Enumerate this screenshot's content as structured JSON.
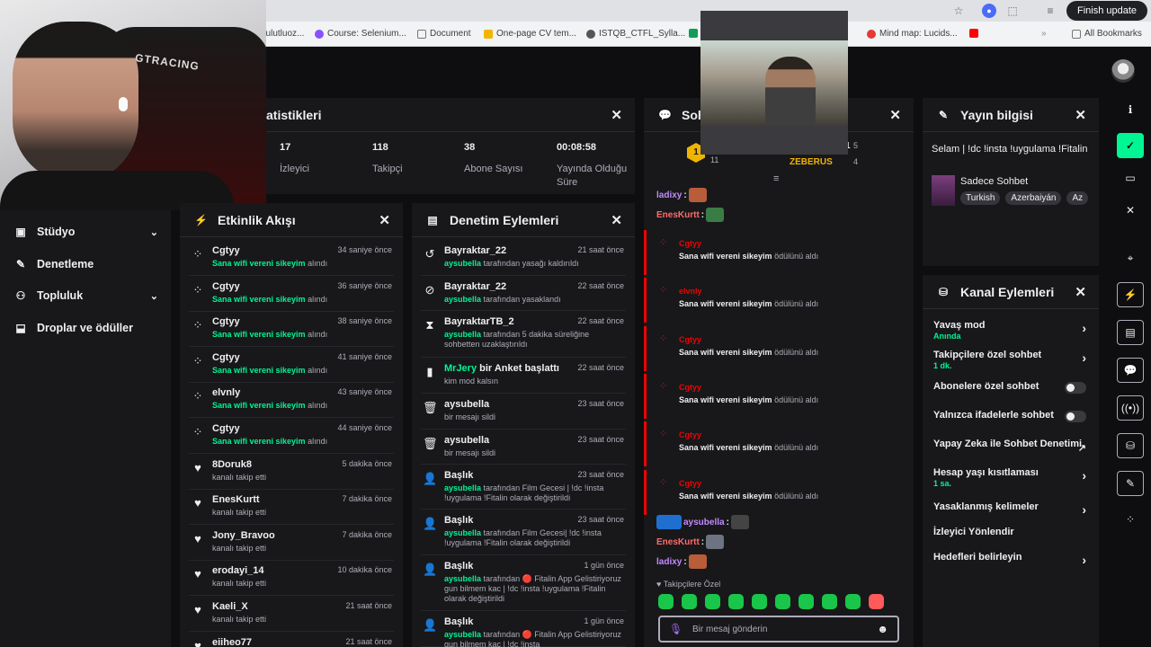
{
  "browser": {
    "bookmarks": [
      {
        "label": "bulutluoz...",
        "color": "#777"
      },
      {
        "label": "Course: Selenium...",
        "color": "#8a4fff"
      },
      {
        "label": "Document",
        "color": "#777"
      },
      {
        "label": "One-page CV tem...",
        "color": "#f4b400"
      },
      {
        "label": "ISTQB_CTFL_Sylla...",
        "color": "#555"
      },
      {
        "label": "Mind map: Lucids...",
        "color": "#e53935"
      },
      {
        "label": "All Bookmarks",
        "color": "#777"
      }
    ],
    "finish_update": "Finish update"
  },
  "webcam": {
    "chair_text": "GTRACING"
  },
  "leftnav": {
    "items": [
      {
        "label": "Stüdyo",
        "icon": "studio-icon",
        "glyph": "▣",
        "chevron": true
      },
      {
        "label": "Denetleme",
        "icon": "wrench-icon",
        "glyph": "🔧",
        "chevron": false
      },
      {
        "label": "Topluluk",
        "icon": "community-icon",
        "glyph": "👥",
        "chevron": true
      },
      {
        "label": "Droplar ve ödüller",
        "icon": "drops-icon",
        "glyph": "⬓",
        "chevron": false
      }
    ]
  },
  "stats": {
    "title": "atistikleri",
    "items": [
      {
        "value": "17",
        "label": "İzleyici"
      },
      {
        "value": "118",
        "label": "Takipçi"
      },
      {
        "value": "38",
        "label": "Abone Sayısı"
      },
      {
        "value": "00:08:58",
        "label": "Yayında Olduğu Süre"
      }
    ]
  },
  "activity": {
    "title": "Etkinlik Akışı",
    "rows": [
      {
        "name": "Cgtyy",
        "time": "34 saniye önce",
        "reward": "Sana wifi vereni sikeyim",
        "suffix": "alındı",
        "type": "points"
      },
      {
        "name": "Cgtyy",
        "time": "36 saniye önce",
        "reward": "Sana wifi vereni sikeyim",
        "suffix": "alındı",
        "type": "points"
      },
      {
        "name": "Cgtyy",
        "time": "38 saniye önce",
        "reward": "Sana wifi vereni sikeyim",
        "suffix": "alındı",
        "type": "points"
      },
      {
        "name": "Cgtyy",
        "time": "41 saniye önce",
        "reward": "Sana wifi vereni sikeyim",
        "suffix": "alındı",
        "type": "points"
      },
      {
        "name": "elvnly",
        "time": "43 saniye önce",
        "reward": "Sana wifi vereni sikeyim",
        "suffix": "alındı",
        "type": "points"
      },
      {
        "name": "Cgtyy",
        "time": "44 saniye önce",
        "reward": "Sana wifi vereni sikeyim",
        "suffix": "alındı",
        "type": "points"
      },
      {
        "name": "8Doruk8",
        "time": "5 dakika önce",
        "reward": "",
        "suffix": "kanalı takip etti",
        "type": "follow"
      },
      {
        "name": "EnesKurtt",
        "time": "7 dakika önce",
        "reward": "",
        "suffix": "kanalı takip etti",
        "type": "follow"
      },
      {
        "name": "Jony_Bravoo",
        "time": "7 dakika önce",
        "reward": "",
        "suffix": "kanalı takip etti",
        "type": "follow"
      },
      {
        "name": "erodayi_14",
        "time": "10 dakika önce",
        "reward": "",
        "suffix": "kanalı takip etti",
        "type": "follow"
      },
      {
        "name": "Kaeli_X",
        "time": "21 saat önce",
        "reward": "",
        "suffix": "kanalı takip etti",
        "type": "follow"
      },
      {
        "name": "eiiheo77",
        "time": "21 saat önce",
        "reward": "",
        "suffix": "",
        "type": "follow"
      }
    ]
  },
  "moderation": {
    "title": "Denetim Eylemleri",
    "rows": [
      {
        "glyph": "↺",
        "icon": "unban-icon",
        "name": "Bayraktar_22",
        "time": "21 saat önce",
        "actor": "aysubella",
        "text": "tarafından yasağı kaldırıldı"
      },
      {
        "glyph": "⊘",
        "icon": "ban-icon",
        "name": "Bayraktar_22",
        "time": "22 saat önce",
        "actor": "aysubella",
        "text": "tarafından yasaklandı"
      },
      {
        "glyph": "⧗",
        "icon": "timeout-icon",
        "name": "BayraktarTB_2",
        "time": "22 saat önce",
        "actor": "aysubella",
        "text": "tarafından 5 dakika süreliğine sohbetten uzaklaştırıldı"
      },
      {
        "glyph": "▮",
        "icon": "poll-icon",
        "name": "MrJery",
        "name_suffix": " bir Anket başlattı",
        "time": "22 saat önce",
        "actor": "",
        "text": "kim mod kalsın"
      },
      {
        "glyph": "🗑",
        "icon": "trash-icon",
        "name": "aysubella",
        "time": "23 saat önce",
        "actor": "",
        "text": "bir mesajı sildi"
      },
      {
        "glyph": "🗑",
        "icon": "trash-icon",
        "name": "aysubella",
        "time": "23 saat önce",
        "actor": "",
        "text": "bir mesajı sildi"
      },
      {
        "glyph": "👤",
        "icon": "title-edit-icon",
        "name": "Başlık",
        "time": "23 saat önce",
        "actor": "aysubella",
        "text": "tarafından Film Gecesi | !dc !insta !uygulama !Fitalin olarak değiştirildi"
      },
      {
        "glyph": "👤",
        "icon": "title-edit-icon",
        "name": "Başlık",
        "time": "23 saat önce",
        "actor": "aysubella",
        "text": "tarafından Film Gecesi| !dc !insta !uygulama !Fitalin olarak değiştirildi"
      },
      {
        "glyph": "👤",
        "icon": "title-edit-icon",
        "name": "Başlık",
        "time": "1 gün önce",
        "actor": "aysubella",
        "text": "tarafından 🔴 Fitalin App Gelistiriyoruz gun bilmem kac | !dc !insta !uygulama !Fitalin olarak değiştirildi"
      },
      {
        "glyph": "👤",
        "icon": "title-edit-icon",
        "name": "Başlık",
        "time": "1 gün önce",
        "actor": "aysubella",
        "text": "tarafından 🔴 Fitalin App Gelistiriyoruz gun bilmem kac | !dc !insta"
      }
    ]
  },
  "chat": {
    "title": "Soh",
    "leaderboard": {
      "top_rank": "1",
      "top_count": "11",
      "right_rank": "1",
      "right_count_a": "5",
      "right_count_b": "4",
      "right_name": "ZEBERUS"
    },
    "top_lines": [
      {
        "name": "ladixy",
        "color": "#c28bff"
      },
      {
        "name": "EnesKurtt",
        "color": "#ff6b6b"
      }
    ],
    "redeems": [
      {
        "name": "Cgtyy",
        "text": "Sana wifi vereni sikeyim",
        "suffix": "ödülünü aldı"
      },
      {
        "name": "elvnly",
        "text": "Sana wifi vereni sikeyim",
        "suffix": "ödülünü aldı"
      },
      {
        "name": "Cgtyy",
        "text": "Sana wifi vereni sikeyim",
        "suffix": "ödülünü aldı"
      },
      {
        "name": "Cgtyy",
        "text": "Sana wifi vereni sikeyim",
        "suffix": "ödülünü aldı"
      },
      {
        "name": "Cgtyy",
        "text": "Sana wifi vereni sikeyim",
        "suffix": "ödülünü aldı"
      },
      {
        "name": "Cgtyy",
        "text": "Sana wifi vereni sikeyim",
        "suffix": "ödülünü aldı"
      }
    ],
    "bottom_lines": [
      {
        "name": "aysubella",
        "color": "#c28bff"
      },
      {
        "name": "EnesKurtt",
        "color": "#ff6b6b"
      },
      {
        "name": "ladixy",
        "color": "#c28bff"
      }
    ],
    "followers_only": "Takipçilere Özel",
    "input_placeholder": "Bir mesaj gönderin"
  },
  "stream_info": {
    "title": "Yayın bilgisi",
    "stream_title": "Selam | !dc !insta !uygulama !Fitalin",
    "category": "Sadece Sohbet",
    "tags": [
      "Turkish",
      "Azerbaiyán",
      "Az"
    ]
  },
  "channel_actions": {
    "title": "Kanal Eylemleri",
    "items": [
      {
        "label": "Yavaş mod",
        "sub": "Anında",
        "control": "chevron"
      },
      {
        "label": "Takipçilere özel sohbet",
        "sub": "1 dk.",
        "control": "chevron"
      },
      {
        "label": "Abonelere özel sohbet",
        "sub": "",
        "control": "toggle"
      },
      {
        "label": "Yalnızca ifadelerle sohbet",
        "sub": "",
        "control": "toggle"
      },
      {
        "label": "Yapay Zeka ile Sohbet Denetimi",
        "sub": "",
        "control": "external"
      },
      {
        "label": "Hesap yaşı kısıtlaması",
        "sub": "1 sa.",
        "control": "chevron"
      },
      {
        "label": "Yasaklanmış kelimeler",
        "sub": "",
        "control": "chevron"
      },
      {
        "label": "İzleyici Yönlendir",
        "sub": "",
        "control": "none"
      },
      {
        "label": "Hedefleri belirleyin",
        "sub": "",
        "control": "chevron"
      }
    ]
  },
  "colors": {
    "accent_green": "#00f593",
    "danger": "#eb0400",
    "panel": "#18181b",
    "bg": "#0e0e10"
  }
}
